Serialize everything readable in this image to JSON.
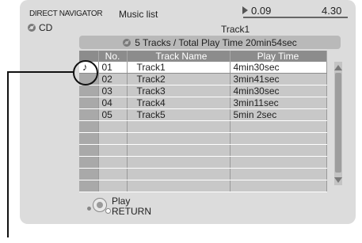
{
  "header": {
    "navigator_label": "DIRECT NAVIGATOR",
    "screen_title": "Music list",
    "media_label": "CD",
    "time_current": "0.09",
    "time_total": "4.30",
    "playback_progress": 0.033,
    "current_track": "Track1"
  },
  "summary": {
    "text": "5 Tracks / Total Play Time 20min54sec"
  },
  "table": {
    "columns": [
      "No.",
      "Track Name",
      "Play Time"
    ],
    "rows": [
      {
        "no": "01",
        "name": "Track1",
        "time": "4min30sec",
        "selected": true,
        "icon": "music-note"
      },
      {
        "no": "02",
        "name": "Track2",
        "time": "3min41sec"
      },
      {
        "no": "03",
        "name": "Track3",
        "time": "4min30sec"
      },
      {
        "no": "04",
        "name": "Track4",
        "time": "3min11sec"
      },
      {
        "no": "05",
        "name": "Track5",
        "time": "5min  2sec"
      }
    ],
    "empty_rows": 6
  },
  "controls": {
    "play_label": "Play",
    "return_label": "RETURN"
  },
  "icons": {
    "disc": "disc-icon",
    "note": "music-note-icon",
    "dial": "select-dial-icon"
  },
  "colors": {
    "screen_bg": "#dcdcdc",
    "header_row": "#8c8c8c",
    "row_bg": "#c8c8c8",
    "selected_row": "#ffffff"
  }
}
